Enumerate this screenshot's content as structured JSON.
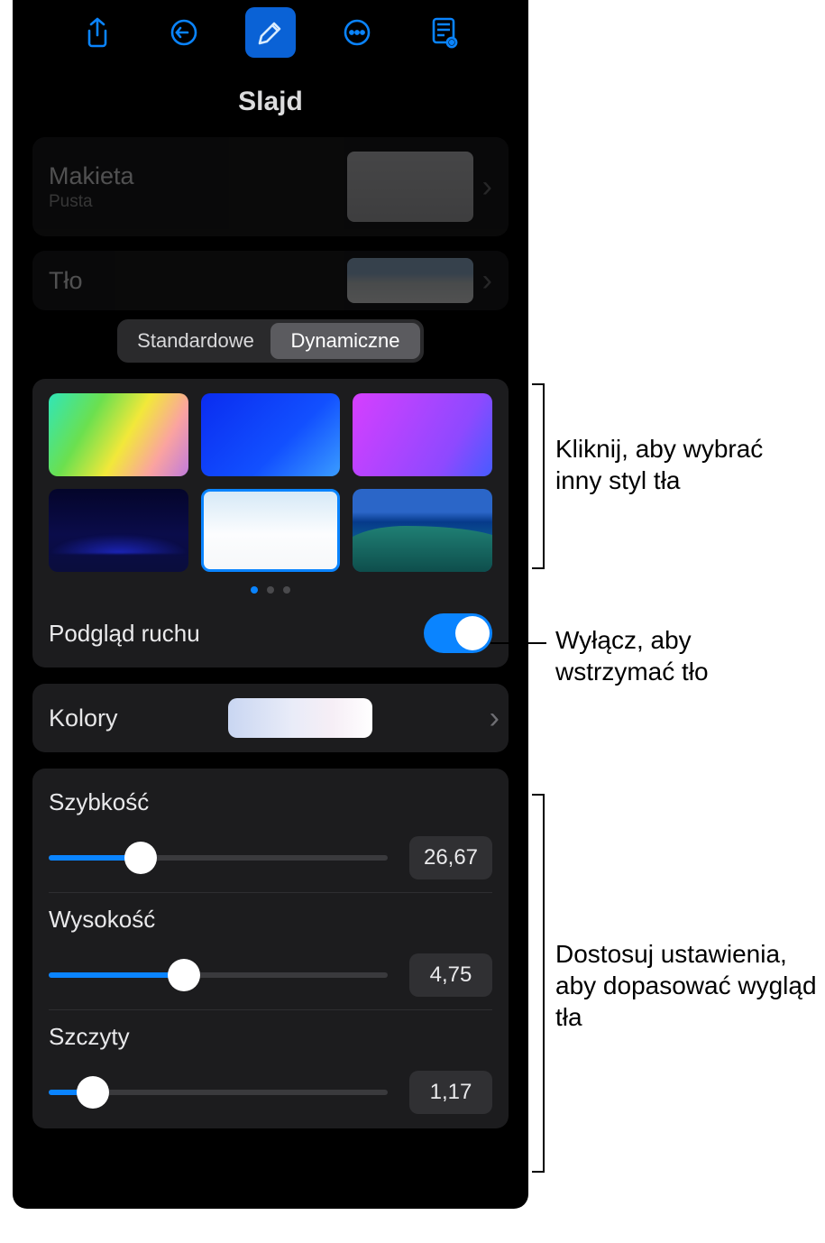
{
  "toolbar": {
    "share_icon": "share",
    "undo_icon": "undo",
    "brush_icon": "brush",
    "more_icon": "more",
    "doc_icon": "document-eye"
  },
  "panel_title": "Slajd",
  "layout": {
    "label": "Makieta",
    "sub": "Pusta"
  },
  "background": {
    "label": "Tło"
  },
  "segmented": {
    "standard": "Standardowe",
    "dynamic": "Dynamiczne",
    "selected": "dynamic"
  },
  "motion": {
    "label": "Podgląd ruchu",
    "on": true
  },
  "colors": {
    "label": "Kolory"
  },
  "sliders": {
    "speed": {
      "label": "Szybkość",
      "value": "26,67",
      "pct": 27
    },
    "height": {
      "label": "Wysokość",
      "value": "4,75",
      "pct": 40
    },
    "peaks": {
      "label": "Szczyty",
      "value": "1,17",
      "pct": 13
    }
  },
  "callouts": {
    "styles": "Kliknij, aby wybrać inny styl tła",
    "motion": "Wyłącz, aby wstrzymać tło",
    "sliders": "Dostosuj ustawienia, aby dopasować wygląd tła"
  }
}
